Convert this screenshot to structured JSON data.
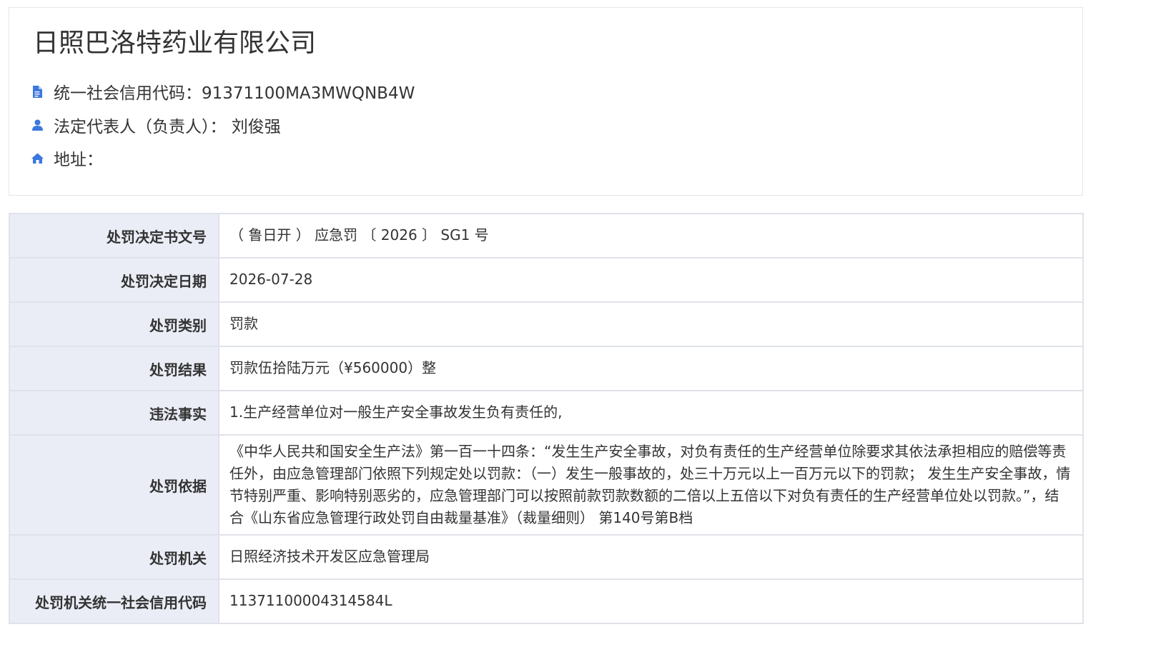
{
  "company": {
    "name": "日照巴洛特药业有限公司",
    "credit_code_line": "统一社会信用代码：91371100MA3MWQNB4W",
    "legal_rep_line": "法定代表人（负责人）： 刘俊强",
    "address_line": "地址："
  },
  "icons": {
    "credit": "document-icon",
    "legal": "user-icon",
    "address": "home-icon",
    "color": "#3b78dd"
  },
  "penalty": {
    "rows": [
      {
        "label": "处罚决定书文号",
        "value": "（ 鲁日开 ） 应急罚 〔 2026 〕 SG1 号"
      },
      {
        "label": "处罚决定日期",
        "value": "2026-07-28"
      },
      {
        "label": "处罚类别",
        "value": "罚款"
      },
      {
        "label": "处罚结果",
        "value": "罚款伍拾陆万元（¥560000）整"
      },
      {
        "label": "违法事实",
        "value": "1.生产经营单位对一般生产安全事故发生负有责任的,"
      },
      {
        "label": "处罚依据",
        "value": "《中华人民共和国安全生产法》第一百一十四条：“发生生产安全事故，对负有责任的生产经营单位除要求其依法承担相应的赔偿等责任外，由应急管理部门依照下列规定处以罚款：（一）发生一般事故的，处三十万元以上一百万元以下的罚款； 发生生产安全事故，情节特别严重、影响特别恶劣的，应急管理部门可以按照前款罚款数额的二倍以上五倍以下对负有责任的生产经营单位处以罚款。”，结合《山东省应急管理行政处罚自由裁量基准》（裁量细则） 第140号第B档"
      },
      {
        "label": "处罚机关",
        "value": "日照经济技术开发区应急管理局"
      },
      {
        "label": "处罚机关统一社会信用代码",
        "value": "11371100004314584L"
      }
    ]
  }
}
